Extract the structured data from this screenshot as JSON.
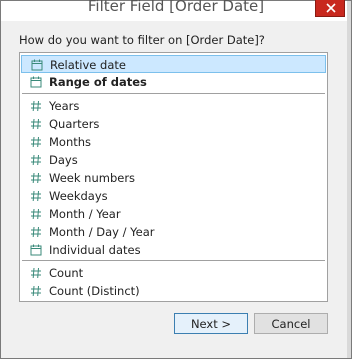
{
  "dialog": {
    "title": "Filter Field [Order Date]",
    "prompt": "How do you want to filter on [Order Date]?"
  },
  "list": {
    "items": [
      {
        "label": "Relative date",
        "icon": "calendar-icon",
        "selected": true,
        "bold": false
      },
      {
        "label": "Range of dates",
        "icon": "calendar-icon",
        "selected": false,
        "bold": true
      },
      {
        "label": "Years",
        "icon": "hash-icon",
        "selected": false,
        "bold": false
      },
      {
        "label": "Quarters",
        "icon": "hash-icon",
        "selected": false,
        "bold": false
      },
      {
        "label": "Months",
        "icon": "hash-icon",
        "selected": false,
        "bold": false
      },
      {
        "label": "Days",
        "icon": "hash-icon",
        "selected": false,
        "bold": false
      },
      {
        "label": "Week numbers",
        "icon": "hash-icon",
        "selected": false,
        "bold": false
      },
      {
        "label": "Weekdays",
        "icon": "hash-icon",
        "selected": false,
        "bold": false
      },
      {
        "label": "Month / Year",
        "icon": "hash-icon",
        "selected": false,
        "bold": false
      },
      {
        "label": "Month / Day / Year",
        "icon": "hash-icon",
        "selected": false,
        "bold": false
      },
      {
        "label": "Individual dates",
        "icon": "calendar-icon",
        "selected": false,
        "bold": false
      },
      {
        "label": "Count",
        "icon": "hash-icon",
        "selected": false,
        "bold": false
      },
      {
        "label": "Count (Distinct)",
        "icon": "hash-icon",
        "selected": false,
        "bold": false
      }
    ]
  },
  "buttons": {
    "next": "Next >",
    "cancel": "Cancel"
  },
  "colors": {
    "selection": "#cce8ff",
    "close": "#c8281e",
    "icon": "#3a8a7a"
  }
}
